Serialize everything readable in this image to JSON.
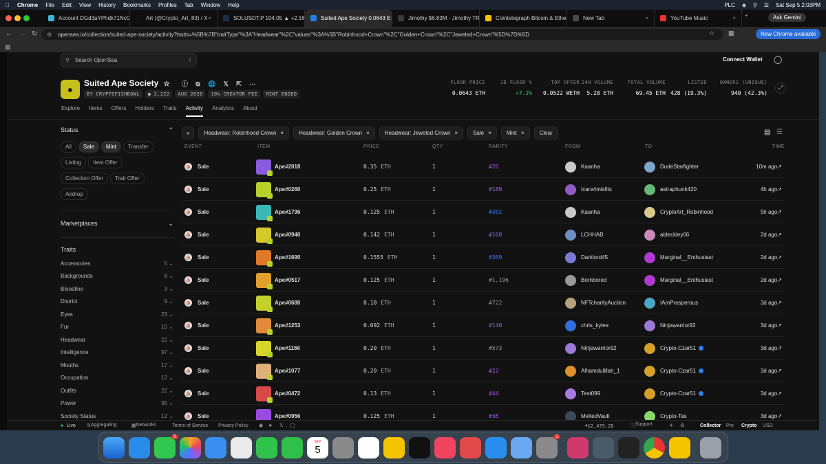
{
  "menubar": {
    "items": [
      "Chrome",
      "File",
      "Edit",
      "View",
      "History",
      "Bookmarks",
      "Profiles",
      "Tab",
      "Window",
      "Help"
    ],
    "right": {
      "user": "PLC",
      "datetime": "Sat Sep 5  2:03PM",
      "gemini": "Ask Gemini"
    }
  },
  "tabs": [
    {
      "label": "Account DGd3aYPhdk71NcGi",
      "color": "#3fb6d6",
      "icon": "wallet-icon"
    },
    {
      "label": "Art (@Crypto_Art_83) / X",
      "color": "#111",
      "icon": "x-icon"
    },
    {
      "label": "SOLUSDT.P 104.05 ▲ +2.16%",
      "color": "#1b2e4a",
      "icon": "chart-icon"
    },
    {
      "label": "Suited Ape Society 0.0643 E",
      "color": "#2081e2",
      "icon": "opensea-icon",
      "active": true
    },
    {
      "label": "Jimothy $6.83M - Jimothy TR",
      "color": "#3a3a3a",
      "icon": "token-icon"
    },
    {
      "label": "Cointelegraph Bitcoin & Ether",
      "color": "#f5c400",
      "icon": "news-icon"
    },
    {
      "label": "New Tab",
      "color": "#4a4a4a",
      "icon": "globe-icon"
    },
    {
      "label": "YouTube Music",
      "color": "#e33",
      "icon": "music-icon"
    }
  ],
  "address": {
    "url": "opensea.io/collection/suited-ape-society/activity?traits=%5B%7B\"traitType\"%3A\"Headwear\"%2C\"values\"%3A%5B\"Robinhood+Crown\"%2C\"Golden+Crown\"%2C\"Jeweled+Crown\"%5D%7D%5D",
    "new_chrome": "New Chrome available"
  },
  "header": {
    "search_placeholder": "Search OpenSea",
    "search_shortcut": "/",
    "connect": "Connect Wallet"
  },
  "collection": {
    "name": "Suited Ape Society",
    "creator": "BY CRYPTOFISHBOWL",
    "items": "2,222",
    "date": "AUG 2026",
    "fee": "10% CREATOR FEE",
    "mint": "MINT ENDED"
  },
  "stats": [
    {
      "label": "FLOOR PRICE",
      "value": "0.0643 ETH",
      "color": "#ffffff"
    },
    {
      "label": "1D FLOOR %",
      "value": "+7.2%",
      "color": "#3ccf6e"
    },
    {
      "label": "TOP OFFER",
      "value": "0.0522 WETH",
      "color": "#ffffff"
    },
    {
      "label": "24H VOLUME",
      "value": "5.28 ETH",
      "color": "#ffffff"
    },
    {
      "label": "TOTAL VOLUME",
      "value": "69.45 ETH",
      "color": "#ffffff"
    },
    {
      "label": "LISTED",
      "value": "428 (19.3%)",
      "color": "#ffffff"
    },
    {
      "label": "OWNERS (UNIQUE)",
      "value": "940 (42.3%)",
      "color": "#ffffff"
    }
  ],
  "nav": [
    "Explore",
    "Items",
    "Offers",
    "Holders",
    "Traits",
    "Activity",
    "Analytics",
    "About"
  ],
  "sidebar": {
    "status_title": "Status",
    "status_pills": [
      {
        "label": "All"
      },
      {
        "label": "Sale",
        "on": true
      },
      {
        "label": "Mint",
        "on": true
      },
      {
        "label": "Transfer"
      },
      {
        "label": "Listing"
      },
      {
        "label": "Item Offer"
      },
      {
        "label": "Collection Offer"
      },
      {
        "label": "Trait Offer"
      },
      {
        "label": "Airdrop"
      }
    ],
    "marketplaces": "Marketplaces",
    "traits_title": "Traits",
    "traits": [
      {
        "name": "Accessories",
        "count": "5"
      },
      {
        "name": "Backgrounds",
        "count": "8"
      },
      {
        "name": "Bloodline",
        "count": "3"
      },
      {
        "name": "District",
        "count": "9"
      },
      {
        "name": "Eyes",
        "count": "23"
      },
      {
        "name": "Fur",
        "count": "15"
      },
      {
        "name": "Headwear",
        "count": "22"
      },
      {
        "name": "Intelligence",
        "count": "97"
      },
      {
        "name": "Mouths",
        "count": "17"
      },
      {
        "name": "Occupation",
        "count": "12"
      },
      {
        "name": "Outfits",
        "count": "22"
      },
      {
        "name": "Power",
        "count": "95"
      },
      {
        "name": "Society Status",
        "count": "12"
      }
    ]
  },
  "filters": [
    "Headwear: Robinhood Crown",
    "Headwear: Golden Crown",
    "Headwear: Jeweled Crown",
    "Sale",
    "Mint"
  ],
  "clear_label": "Clear",
  "columns": [
    "EVENT",
    "ITEM",
    "PRICE",
    "QTY",
    "RARITY",
    "FROM",
    "TO",
    "TIME"
  ],
  "rows": [
    {
      "event": "Sale",
      "item": "Ape#2018",
      "price": "0.35",
      "unit": "ETH",
      "qty": "1",
      "rarity": "#26",
      "rarity_color": "#a25bf5",
      "from": "Kaanha",
      "to": "DudeStarfighter",
      "to_verified": false,
      "time": "10m ago",
      "thumb": "#8a5be0",
      "from_av": "#c9c9c9",
      "to_av": "#7aa7c9"
    },
    {
      "event": "Sale",
      "item": "Ape#0260",
      "price": "0.25",
      "unit": "ETH",
      "qty": "1",
      "rarity": "#189",
      "rarity_color": "#a25bf5",
      "from": "Icare4misfits",
      "to": "astraphunk420",
      "to_verified": false,
      "time": "4h ago",
      "thumb": "#b8d12a",
      "from_av": "#8f5bc4",
      "to_av": "#67b875"
    },
    {
      "event": "Sale",
      "item": "Ape#1796",
      "price": "0.125",
      "unit": "ETH",
      "qty": "1",
      "rarity": "#382",
      "rarity_color": "#2f80ed",
      "from": "Kaanha",
      "to": "CryptoArt_Robinhood",
      "to_verified": false,
      "time": "5h ago",
      "thumb": "#3ab8b8",
      "from_av": "#c9c9c9",
      "to_av": "#d8c88a"
    },
    {
      "event": "Sale",
      "item": "Ape#0940",
      "price": "0.142",
      "unit": "ETH",
      "qty": "1",
      "rarity": "#160",
      "rarity_color": "#a25bf5",
      "from": "LCHHAB",
      "to": "ableckley06",
      "to_verified": false,
      "time": "2d ago",
      "thumb": "#d6c92a",
      "from_av": "#6a8fc4",
      "to_av": "#c88ab8"
    },
    {
      "event": "Sale",
      "item": "Ape#1690",
      "price": "0.1555",
      "unit": "ETH",
      "qty": "1",
      "rarity": "#369",
      "rarity_color": "#2f80ed",
      "from": "Darklord45",
      "to": "Marginal__Enthusiast",
      "to_verified": false,
      "time": "2d ago",
      "thumb": "#e07a2a",
      "from_av": "#7a7ad6",
      "to_av": "#b03ad0"
    },
    {
      "event": "Sale",
      "item": "Ape#0517",
      "price": "0.125",
      "unit": "ETH",
      "qty": "1",
      "rarity": "#1,196",
      "rarity_color": "#9a9a9a",
      "from": "Bornbored",
      "to": "Marginal__Enthusiast",
      "to_verified": false,
      "time": "2d ago",
      "thumb": "#e0a02a",
      "from_av": "#9a9a9a",
      "to_av": "#b03ad0"
    },
    {
      "event": "Sale",
      "item": "Ape#0680",
      "price": "0.10",
      "unit": "ETH",
      "qty": "1",
      "rarity": "#722",
      "rarity_color": "#9a9a9a",
      "from": "NFTcharityAuction",
      "to": "IAmProsperous",
      "to_verified": false,
      "time": "3d ago",
      "thumb": "#c4d12a",
      "from_av": "#b8a27a",
      "to_av": "#4aa8c4"
    },
    {
      "event": "Sale",
      "item": "Ape#1253",
      "price": "0.092",
      "unit": "ETH",
      "qty": "1",
      "rarity": "#140",
      "rarity_color": "#a25bf5",
      "from": "chris_kylee",
      "to": "Ninjawarrior92",
      "to_verified": false,
      "time": "3d ago",
      "thumb": "#e08a3a",
      "from_av": "#2f6fe0",
      "to_av": "#9a7ad6"
    },
    {
      "event": "Sale",
      "item": "Ape#1166",
      "price": "0.20",
      "unit": "ETH",
      "qty": "1",
      "rarity": "#573",
      "rarity_color": "#9a9a9a",
      "from": "Ninjawarrior92",
      "to": "Crypto-Czar51",
      "to_verified": true,
      "time": "3d ago",
      "thumb": "#d6d62a",
      "from_av": "#9a7ad6",
      "to_av": "#d6a02a"
    },
    {
      "event": "Sale",
      "item": "Ape#1077",
      "price": "0.20",
      "unit": "ETH",
      "qty": "1",
      "rarity": "#22",
      "rarity_color": "#a25bf5",
      "from": "Alhamdulillah_1",
      "to": "Crypto-Czar51",
      "to_verified": true,
      "time": "3d ago",
      "thumb": "#e0b07a",
      "from_av": "#e0902a",
      "to_av": "#d6a02a"
    },
    {
      "event": "Sale",
      "item": "Ape#0472",
      "price": "0.13",
      "unit": "ETH",
      "qty": "1",
      "rarity": "#44",
      "rarity_color": "#a25bf5",
      "from": "Test099",
      "to": "Crypto-Czar51",
      "to_verified": true,
      "time": "3d ago",
      "thumb": "#d64a4a",
      "from_av": "#a87ae0",
      "to_av": "#d6a02a"
    },
    {
      "event": "Sale",
      "item": "Ape#0956",
      "price": "0.125",
      "unit": "ETH",
      "qty": "1",
      "rarity": "#36",
      "rarity_color": "#a25bf5",
      "from": "MeltedVault",
      "to": "Crypto-Tas",
      "to_verified": false,
      "time": "3d ago",
      "thumb": "#9a4ae0",
      "from_av": "#3a4a5a",
      "to_av": "#8ad66a"
    }
  ],
  "statusbar": {
    "live": "Live",
    "aggregating": "Aggregating",
    "networks": "Networks",
    "terms": "Terms of Service",
    "privacy": "Privacy Policy",
    "eth_price": "$2,479.28",
    "support": "Support",
    "collector": "Collector",
    "pro": "Pro",
    "crypto": "Crypto",
    "usd": "USD"
  },
  "dock": {
    "calendar_day": "5",
    "calendar_month": "SEP",
    "mail_badge": "5",
    "settings_badge": "1"
  }
}
